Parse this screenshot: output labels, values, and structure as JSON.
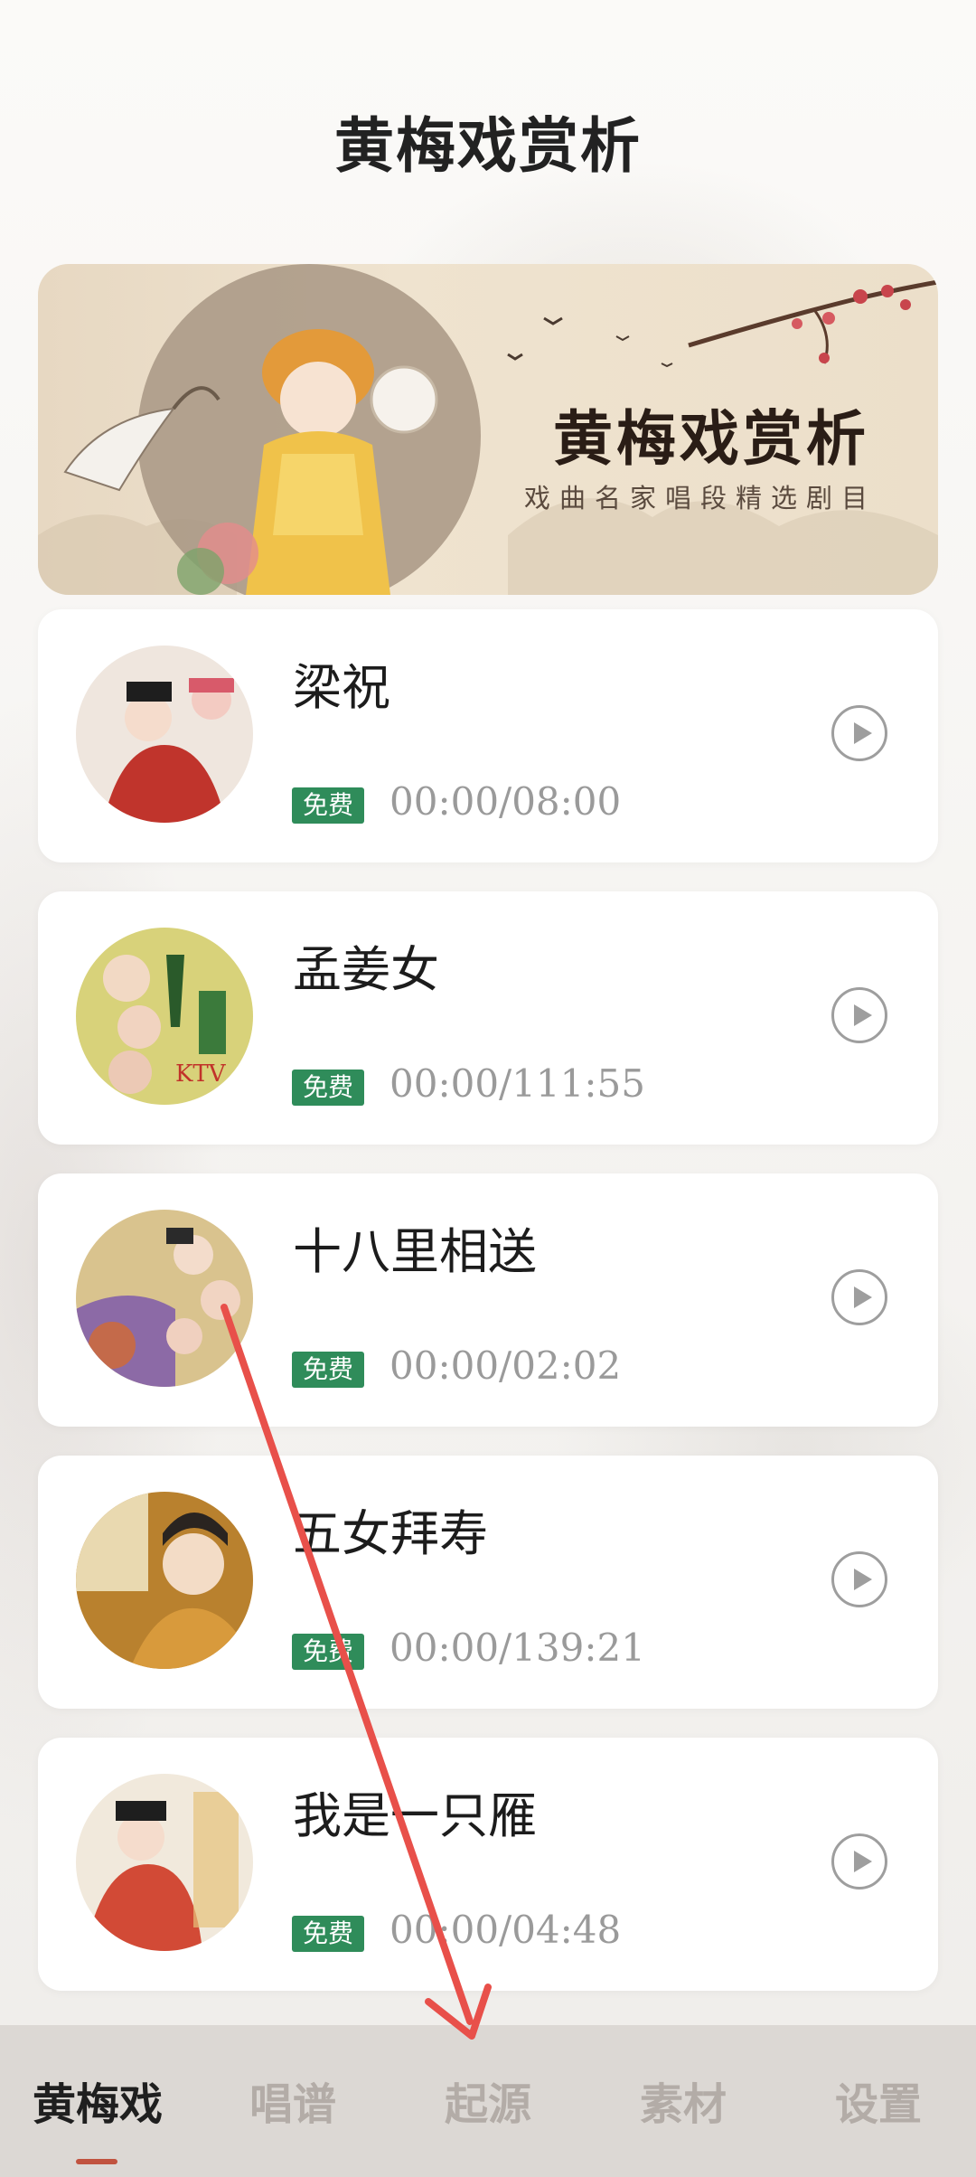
{
  "page": {
    "title": "黄梅戏赏析"
  },
  "banner": {
    "title": "黄梅戏赏析",
    "subtitle": "戏曲名家唱段精选剧目"
  },
  "songs": [
    {
      "title": "梁祝",
      "badge": "免费",
      "duration": "00:00/08:00",
      "cover_color": "#c0342c"
    },
    {
      "title": "孟姜女",
      "badge": "免费",
      "duration": "00:00/111:55",
      "cover_color": "#d8d27a"
    },
    {
      "title": "十八里相送",
      "badge": "免费",
      "duration": "00:00/02:02",
      "cover_color": "#c9a86a"
    },
    {
      "title": "五女拜寿",
      "badge": "免费",
      "duration": "00:00/139:21",
      "cover_color": "#b9812e"
    },
    {
      "title": "我是一只雁",
      "badge": "免费",
      "duration": "00:00/04:48",
      "cover_color": "#d24a36"
    }
  ],
  "tabs": [
    {
      "label": "黄梅戏",
      "active": true
    },
    {
      "label": "唱谱",
      "active": false
    },
    {
      "label": "起源",
      "active": false
    },
    {
      "label": "素材",
      "active": false
    },
    {
      "label": "设置",
      "active": false
    }
  ],
  "colors": {
    "badge_green": "#2f8c5a",
    "active_indicator": "#c1533f",
    "tab_bar_bg": "#dcd8d4",
    "annotation_arrow": "#e8504a"
  },
  "icons": {
    "play": "play-circle-icon"
  }
}
